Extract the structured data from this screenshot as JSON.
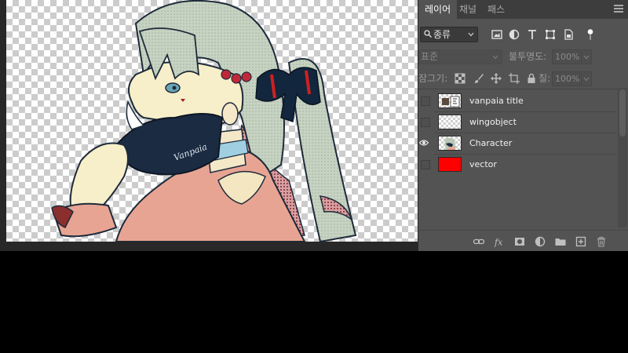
{
  "colors": {
    "panel_bg": "#535353",
    "tab_bar_bg": "#3d3d3d",
    "workspace_bg": "#282828",
    "vector_fill": "#ff0000"
  },
  "canvas": {
    "signature": "Vanpaia"
  },
  "tabs": [
    {
      "label": "레이어",
      "active": true
    },
    {
      "label": "채널",
      "active": false
    },
    {
      "label": "패스",
      "active": false
    }
  ],
  "panel_menu_icon": "panel-menu-icon",
  "filter": {
    "selected": "종류",
    "icons": [
      "pixel-filter-icon",
      "adjustment-filter-icon",
      "type-filter-icon",
      "shape-filter-icon",
      "smart-object-filter-icon",
      "filter-toggle-icon"
    ]
  },
  "blend": {
    "mode": "표준",
    "opacity_label": "불투명도:",
    "opacity_value": "100%"
  },
  "lock": {
    "label": "잠그기:",
    "icons": [
      "lock-transparent-icon",
      "lock-brush-icon",
      "lock-move-icon",
      "lock-artboard-icon",
      "lock-all-icon"
    ],
    "fill_label": "칠:",
    "fill_value": "100%"
  },
  "layers": [
    {
      "name": "vanpaia title",
      "visible": false,
      "thumb": "title"
    },
    {
      "name": "wingobject",
      "visible": false,
      "thumb": "empty"
    },
    {
      "name": "Character",
      "visible": true,
      "thumb": "character"
    },
    {
      "name": "vector",
      "visible": false,
      "thumb": "red"
    }
  ],
  "footer_icons": [
    "link-layers-icon",
    "fx-icon",
    "add-mask-icon",
    "adjustment-layer-icon",
    "new-group-icon",
    "new-layer-icon",
    "trash-icon"
  ]
}
